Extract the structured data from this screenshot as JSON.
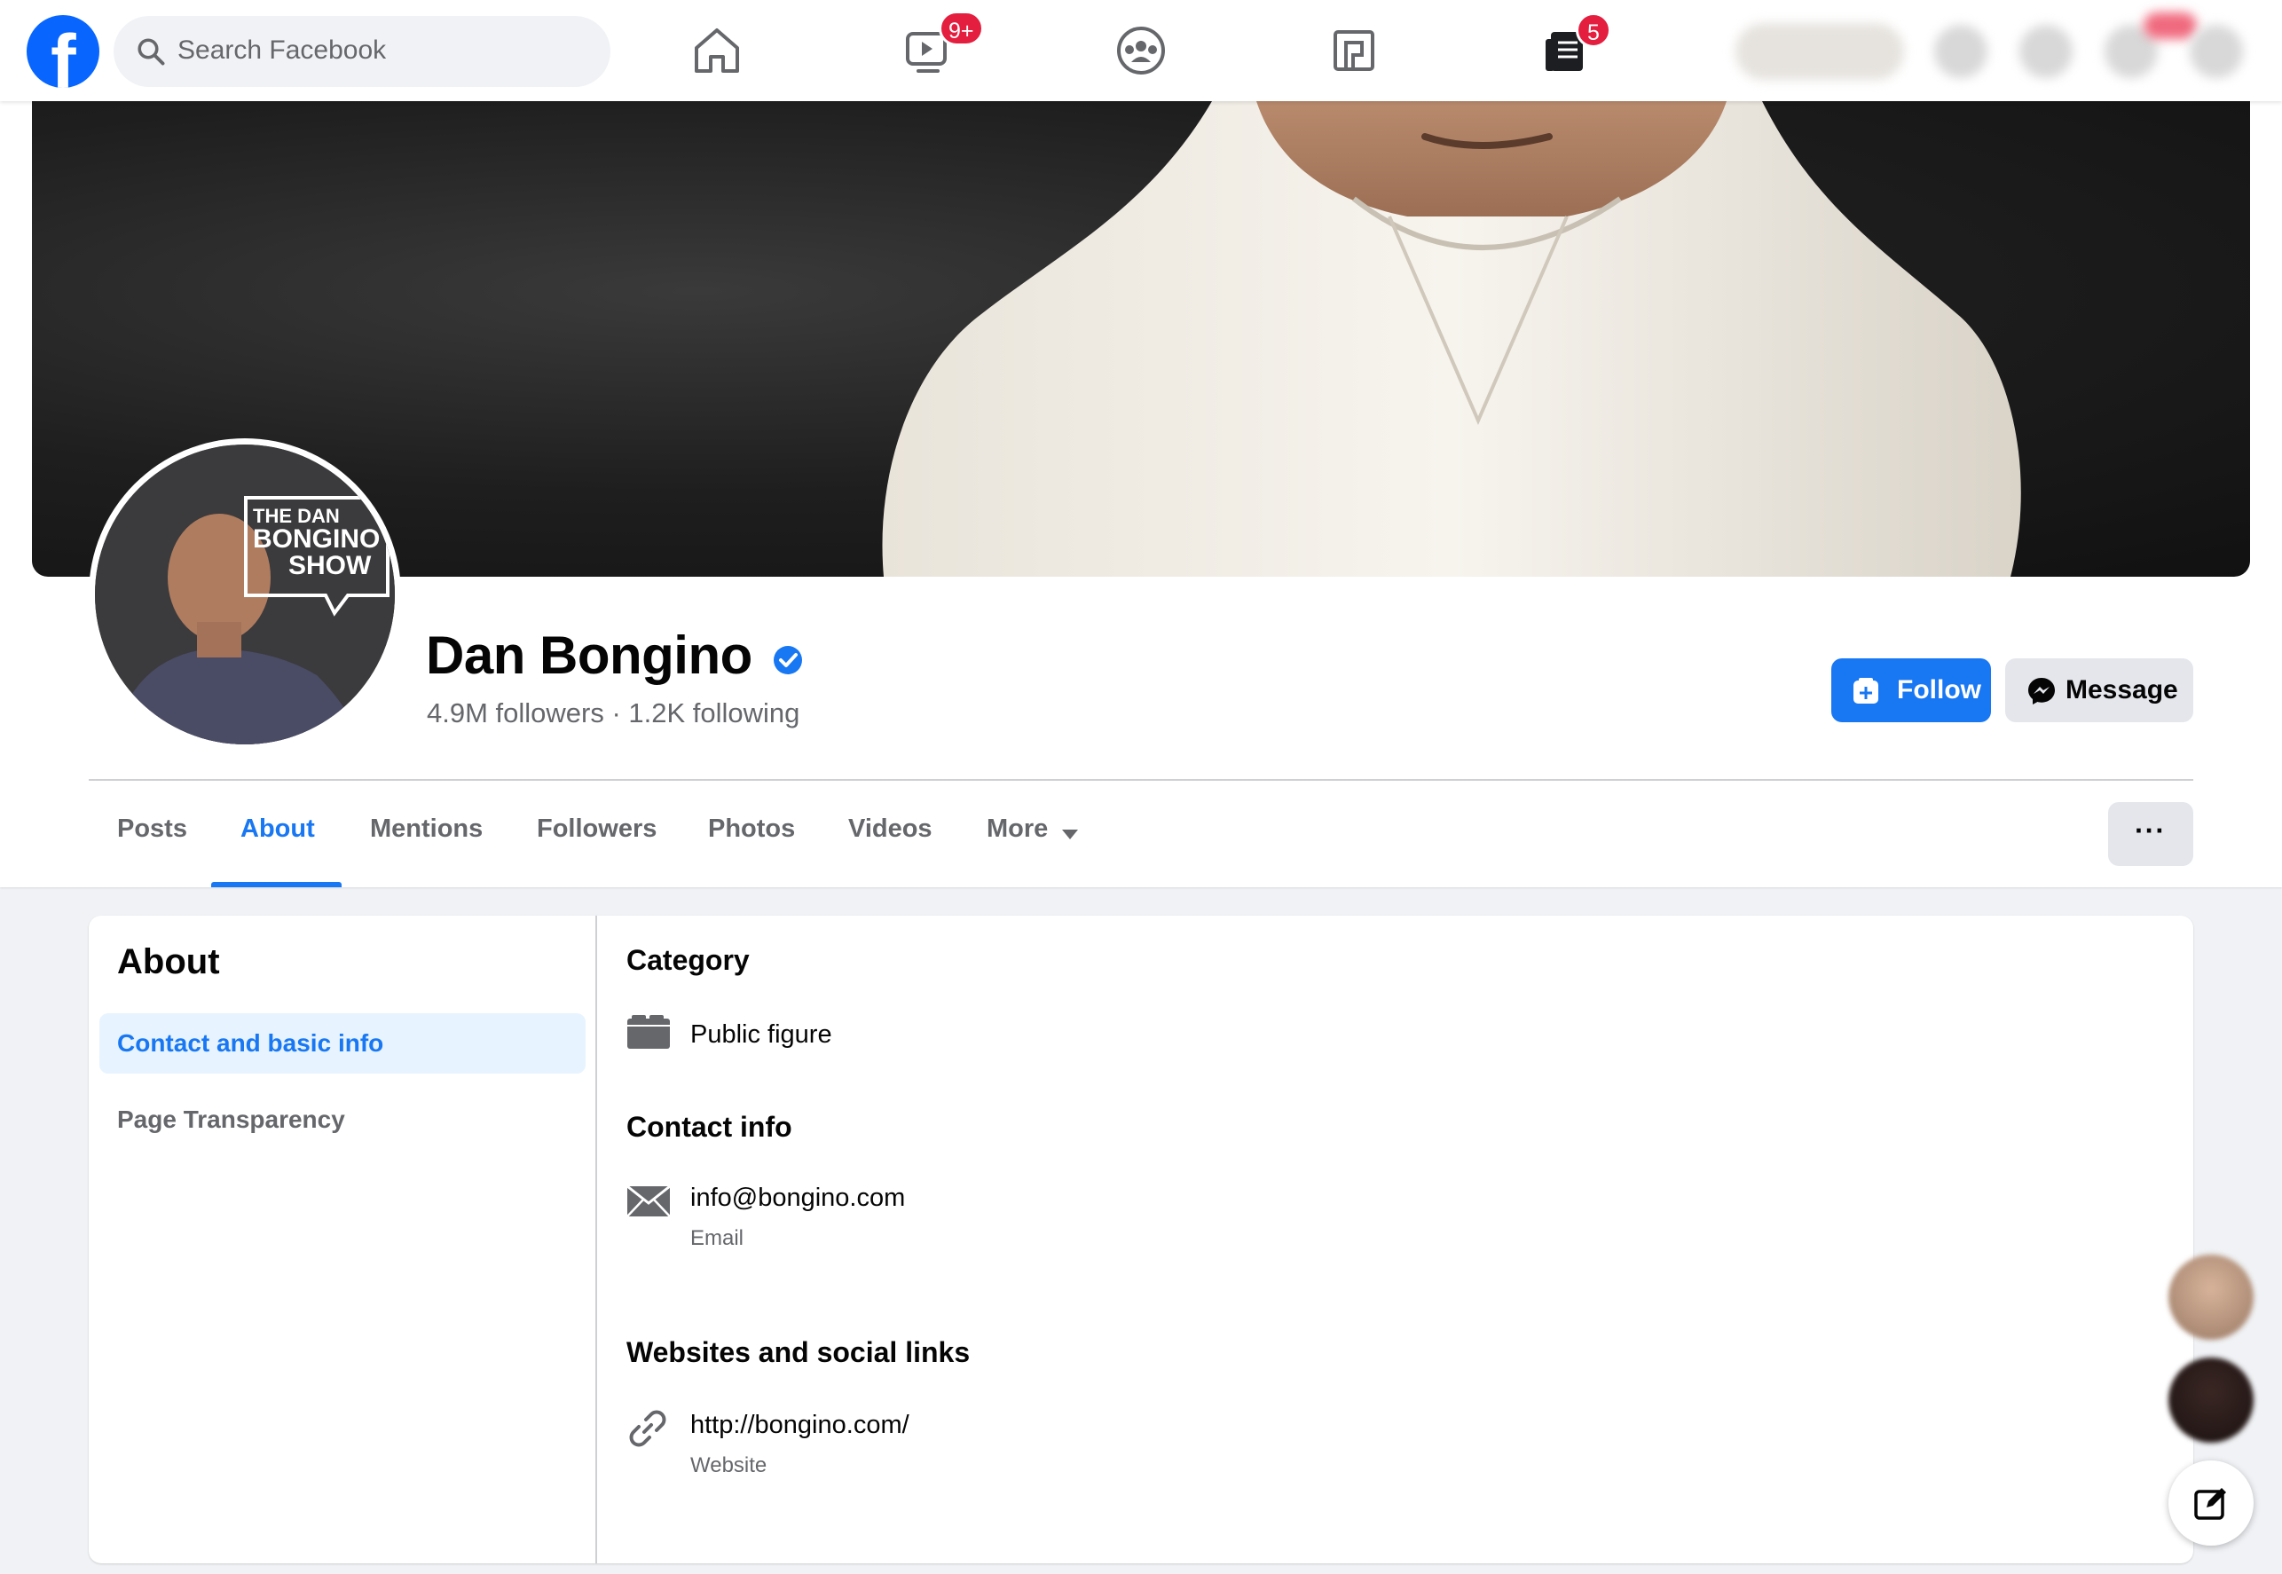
{
  "brand": {
    "logo_letter": "f",
    "accent": "#1877f2",
    "logo_color": "#0866ff",
    "badge_color": "#e41e3f"
  },
  "search": {
    "placeholder": "Search Facebook"
  },
  "nav": {
    "icons": [
      "home-icon",
      "watch-icon",
      "groups-icon",
      "gaming-icon",
      "news-icon"
    ],
    "watch_badge": "9+",
    "news_badge": "5"
  },
  "cover": {
    "avatar_text_line1": "THE DAN",
    "avatar_text_line2": "BONGINO",
    "avatar_text_line3": "SHOW"
  },
  "profile": {
    "name": "Dan Bongino",
    "followers_line": "4.9M followers · 1.2K following",
    "follow_label": "Follow",
    "message_label": "Message"
  },
  "tabs": [
    {
      "label": "Posts"
    },
    {
      "label": "About"
    },
    {
      "label": "Mentions"
    },
    {
      "label": "Followers"
    },
    {
      "label": "Photos"
    },
    {
      "label": "Videos"
    },
    {
      "label": "More"
    }
  ],
  "options_label": "···",
  "about": {
    "title": "About",
    "nav": [
      "Contact and basic info",
      "Page Transparency"
    ],
    "category_heading": "Category",
    "category_value": "Public figure",
    "contact_heading": "Contact info",
    "email_value": "info@bongino.com",
    "email_label": "Email",
    "websites_heading": "Websites and social links",
    "website_value": "http://bongino.com/",
    "website_label": "Website"
  }
}
